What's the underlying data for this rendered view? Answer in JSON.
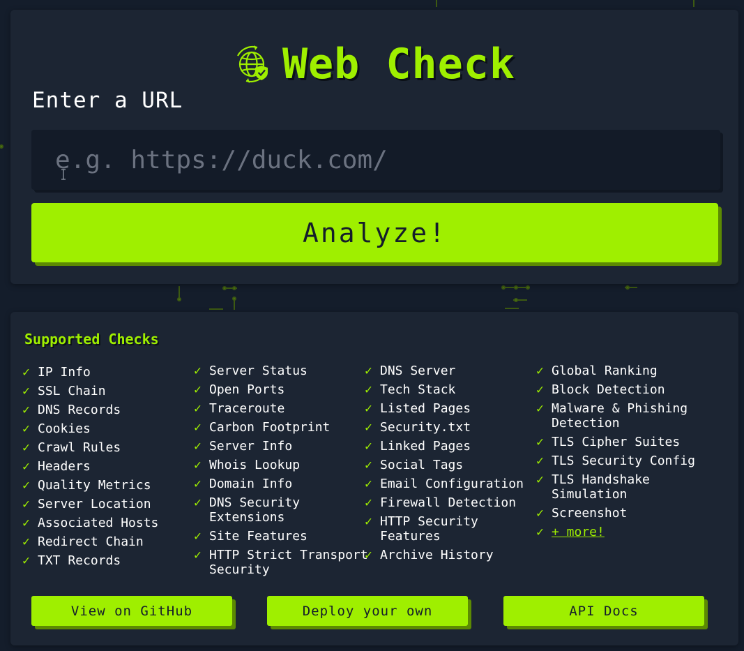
{
  "brand": {
    "title": "Web Check",
    "logo_icon": "globe-shield-icon"
  },
  "url_form": {
    "label": "Enter a URL",
    "input_value": "",
    "input_placeholder": "e.g. https://duck.com/",
    "analyze_label": "Analyze!"
  },
  "checks": {
    "heading": "Supported Checks",
    "tick_glyph": "✓",
    "columns": [
      [
        "IP Info",
        "SSL Chain",
        "DNS Records",
        "Cookies",
        "Crawl Rules",
        "Headers",
        "Quality Metrics",
        "Server Location",
        "Associated Hosts",
        "Redirect Chain",
        "TXT Records"
      ],
      [
        "Server Status",
        "Open Ports",
        "Traceroute",
        "Carbon Footprint",
        "Server Info",
        "Whois Lookup",
        "Domain Info",
        "DNS Security Extensions",
        "Site Features",
        "HTTP Strict Transport Security"
      ],
      [
        "DNS Server",
        "Tech Stack",
        "Listed Pages",
        "Security.txt",
        "Linked Pages",
        "Social Tags",
        "Email Configuration",
        "Firewall Detection",
        "HTTP Security Features",
        "Archive History"
      ],
      [
        "Global Ranking",
        "Block Detection",
        "Malware & Phishing Detection",
        "TLS Cipher Suites",
        "TLS Security Config",
        "TLS Handshake Simulation",
        "Screenshot"
      ]
    ],
    "more_link": "+ more!"
  },
  "footer": {
    "github_label": "View on GitHub",
    "deploy_label": "Deploy your own",
    "api_label": "API Docs"
  },
  "colors": {
    "accent": "#9fef00",
    "background": "#141d2b",
    "panel": "#1c2533",
    "input_bg": "#131b28"
  }
}
